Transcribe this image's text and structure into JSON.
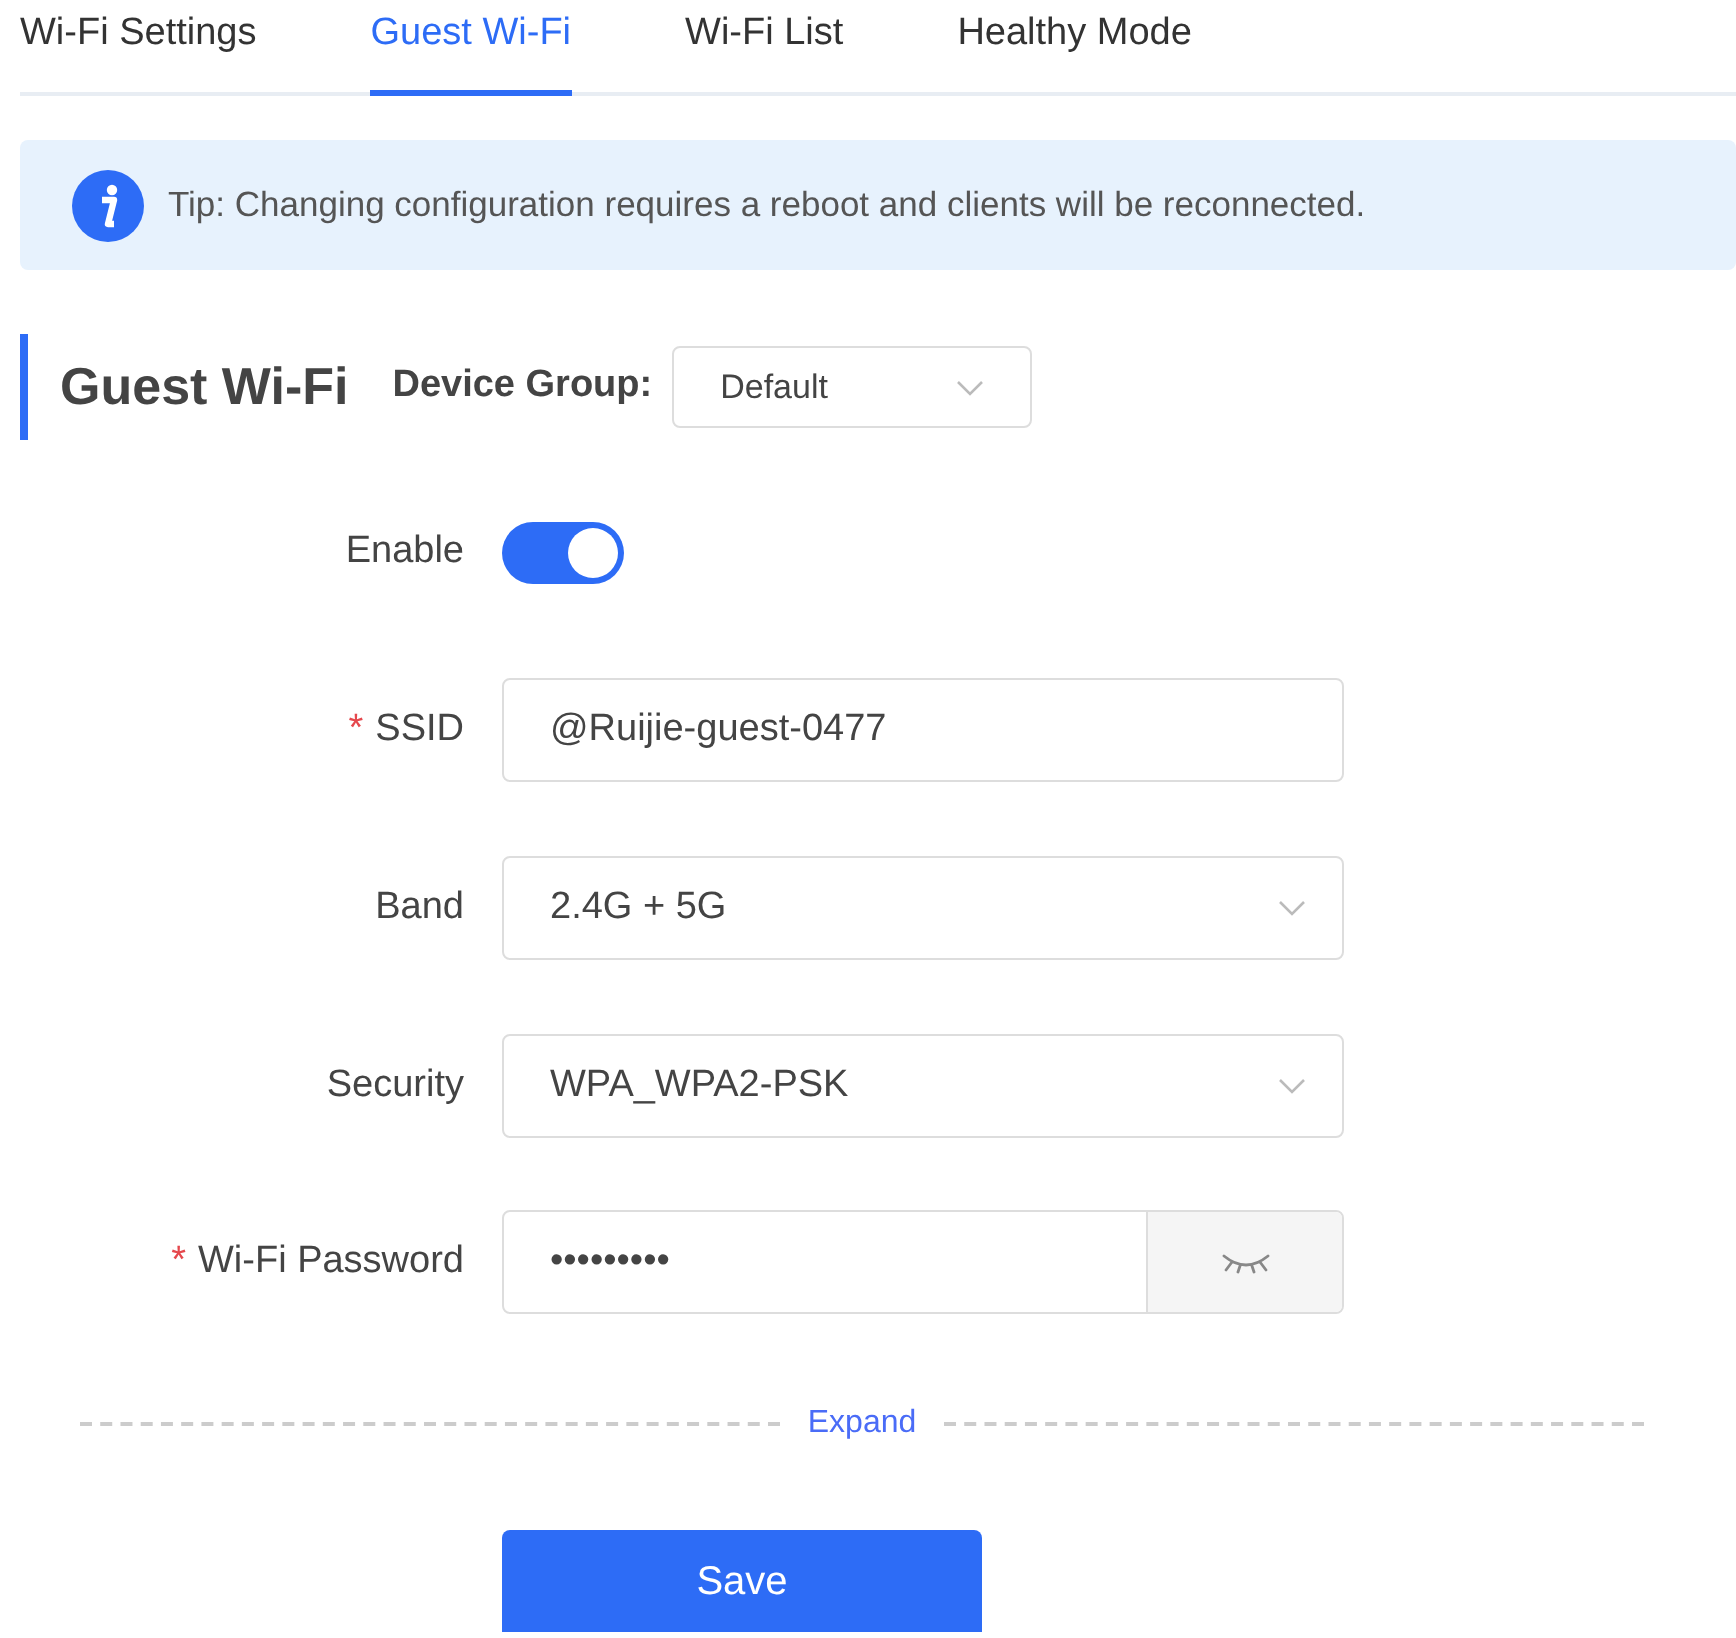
{
  "tabs": [
    {
      "label": "Wi-Fi Settings",
      "selected": false
    },
    {
      "label": "Guest Wi-Fi",
      "selected": true
    },
    {
      "label": "Wi-Fi List",
      "selected": false
    },
    {
      "label": "Healthy Mode",
      "selected": false
    }
  ],
  "tip": "Tip: Changing configuration requires a reboot and clients will be reconnected.",
  "section": {
    "title": "Guest Wi-Fi",
    "group_label": "Device Group:",
    "group_value": "Default"
  },
  "fields": [
    {
      "kind": "toggle",
      "label": "Enable",
      "required": false,
      "on": true
    },
    {
      "kind": "text",
      "label": "SSID",
      "required": true,
      "value": "@Ruijie-guest-0477"
    },
    {
      "kind": "select",
      "label": "Band",
      "required": false,
      "value": "2.4G + 5G"
    },
    {
      "kind": "select",
      "label": "Security",
      "required": false,
      "value": "WPA_WPA2-PSK"
    },
    {
      "kind": "password",
      "label": "Wi-Fi Password",
      "required": true,
      "value": "•••••••••"
    }
  ],
  "required_mark": "*",
  "expand": "Expand",
  "save": "Save"
}
